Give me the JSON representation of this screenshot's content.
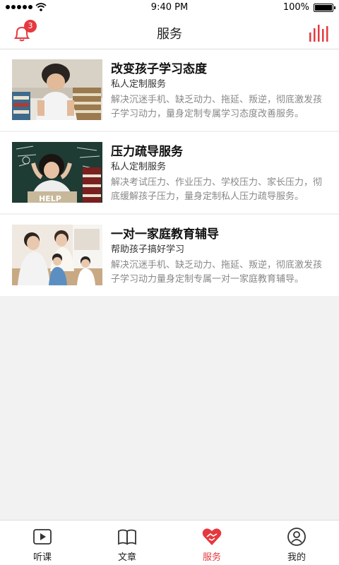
{
  "status": {
    "time": "9:40 PM",
    "battery": "100%"
  },
  "nav": {
    "title": "服务",
    "badge_count": "3",
    "accent": "#e5393f"
  },
  "services": [
    {
      "title": "改变孩子学习态度",
      "subtitle": "私人定制服务",
      "desc": "解决沉迷手机、缺乏动力、拖延、叛逆，彻底激发孩子学习动力，量身定制专属学习态度改善服务。",
      "image": "boy-with-books-photo"
    },
    {
      "title": "压力疏导服务",
      "subtitle": "私人定制服务",
      "desc": "解决考试压力、作业压力、学校压力、家长压力，彻底缓解孩子压力，量身定制私人压力疏导服务。",
      "image": "stressed-girl-help-photo"
    },
    {
      "title": "一对一家庭教育辅导",
      "subtitle": "帮助孩子搞好学习",
      "desc": "解决沉迷手机、缺乏动力、拖延、叛逆，彻底激发孩子学习动力量身定制专属一对一家庭教育辅导。",
      "image": "family-photo"
    }
  ],
  "tabs": [
    {
      "label": "听课",
      "icon": "play-icon"
    },
    {
      "label": "文章",
      "icon": "book-icon"
    },
    {
      "label": "服务",
      "icon": "heart-handshake-icon",
      "active": true
    },
    {
      "label": "我的",
      "icon": "user-icon"
    }
  ]
}
